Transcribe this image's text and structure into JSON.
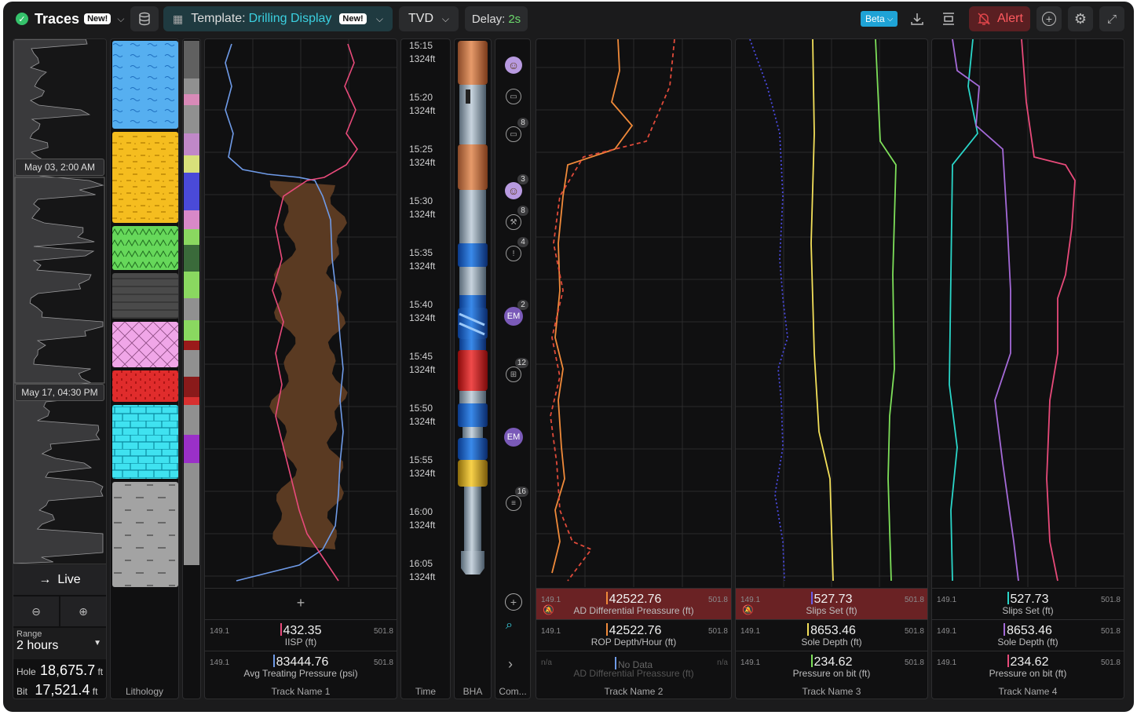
{
  "header": {
    "title": "Traces",
    "title_badge": "New!",
    "template_prefix": "Template:",
    "template_name": "Drilling Display",
    "template_badge": "New!",
    "depth_mode": "TVD",
    "delay_label": "Delay:",
    "delay_value": "2s",
    "beta": "Beta",
    "alert": "Alert"
  },
  "overview": {
    "marker1": "May 03, 2:00 AM",
    "marker2": "May 17, 04:30 PM",
    "live": "Live",
    "range_label": "Range",
    "range_value": "2 hours",
    "hole_label": "Hole",
    "hole_value": "18,675.7",
    "bit_label": "Bit",
    "bit_value": "17,521.4",
    "unit": "ft"
  },
  "columns": {
    "lithology": "Lithology",
    "time": "Time",
    "bha": "BHA",
    "comments": "Com..."
  },
  "time_ticks": [
    {
      "time": "15:15",
      "depth": "1324ft"
    },
    {
      "time": "15:20",
      "depth": "1324ft"
    },
    {
      "time": "15:25",
      "depth": "1324ft"
    },
    {
      "time": "15:30",
      "depth": "1324ft"
    },
    {
      "time": "15:35",
      "depth": "1324ft"
    },
    {
      "time": "15:40",
      "depth": "1324ft"
    },
    {
      "time": "15:45",
      "depth": "1324ft"
    },
    {
      "time": "15:50",
      "depth": "1324ft"
    },
    {
      "time": "15:55",
      "depth": "1324ft"
    },
    {
      "time": "16:00",
      "depth": "1324ft"
    },
    {
      "time": "16:05",
      "depth": "1324ft"
    }
  ],
  "comments": [
    {
      "icon": "avatar-icon",
      "badge": ""
    },
    {
      "icon": "chat-icon",
      "badge": ""
    },
    {
      "icon": "chat-icon",
      "badge": "8"
    },
    {
      "icon": "avatar-icon",
      "badge": "3"
    },
    {
      "icon": "tool-icon",
      "badge": "8"
    },
    {
      "icon": "warning-icon",
      "badge": "4"
    },
    {
      "icon": "EM",
      "badge": "2"
    },
    {
      "icon": "chart-icon",
      "badge": "12"
    },
    {
      "icon": "EM",
      "badge": ""
    },
    {
      "icon": "message-icon",
      "badge": "16"
    }
  ],
  "tracks": [
    {
      "name": "Track Name 1",
      "readouts": [
        {
          "min": "149.1",
          "max": "501.8",
          "value": "432.35",
          "name": "IISP (ft)",
          "color": "#e84a7a"
        },
        {
          "min": "149.1",
          "max": "501.8",
          "value": "83444.76",
          "name": "Avg Treating Pressure (psi)",
          "color": "#6f9be8"
        }
      ]
    },
    {
      "name": "Track Name 2",
      "readouts": [
        {
          "min": "149.1",
          "max": "501.8",
          "value": "42522.76",
          "name": "AD Differential Preassure (ft)",
          "color": "#f08a3a",
          "alert": true
        },
        {
          "min": "149.1",
          "max": "501.8",
          "value": "42522.76",
          "name": "ROP Depth/Hour (ft)",
          "color": "#f08a3a"
        },
        {
          "min": "n/a",
          "max": "n/a",
          "value": "No Data",
          "name": "AD Differential Preassure (ft)",
          "color": "#6f9be8",
          "dim": true
        }
      ]
    },
    {
      "name": "Track Name 3",
      "readouts": [
        {
          "min": "149.1",
          "max": "501.8",
          "value": "527.73",
          "name": "Slips Set (ft)",
          "color": "#6a5ce8",
          "alert": true
        },
        {
          "min": "149.1",
          "max": "501.8",
          "value": "8653.46",
          "name": "Sole Depth (ft)",
          "color": "#f3e05a"
        },
        {
          "min": "149.1",
          "max": "501.8",
          "value": "234.62",
          "name": "Pressure on bit (ft)",
          "color": "#7ee05a"
        }
      ]
    },
    {
      "name": "Track Name 4",
      "readouts": [
        {
          "min": "149.1",
          "max": "501.8",
          "value": "527.73",
          "name": "Slips Set (ft)",
          "color": "#2ad6c9"
        },
        {
          "min": "149.1",
          "max": "501.8",
          "value": "8653.46",
          "name": "Sole Depth (ft)",
          "color": "#a46ad8"
        },
        {
          "min": "149.1",
          "max": "501.8",
          "value": "234.62",
          "name": "Pressure on bit (ft)",
          "color": "#e84a7a"
        }
      ]
    }
  ]
}
